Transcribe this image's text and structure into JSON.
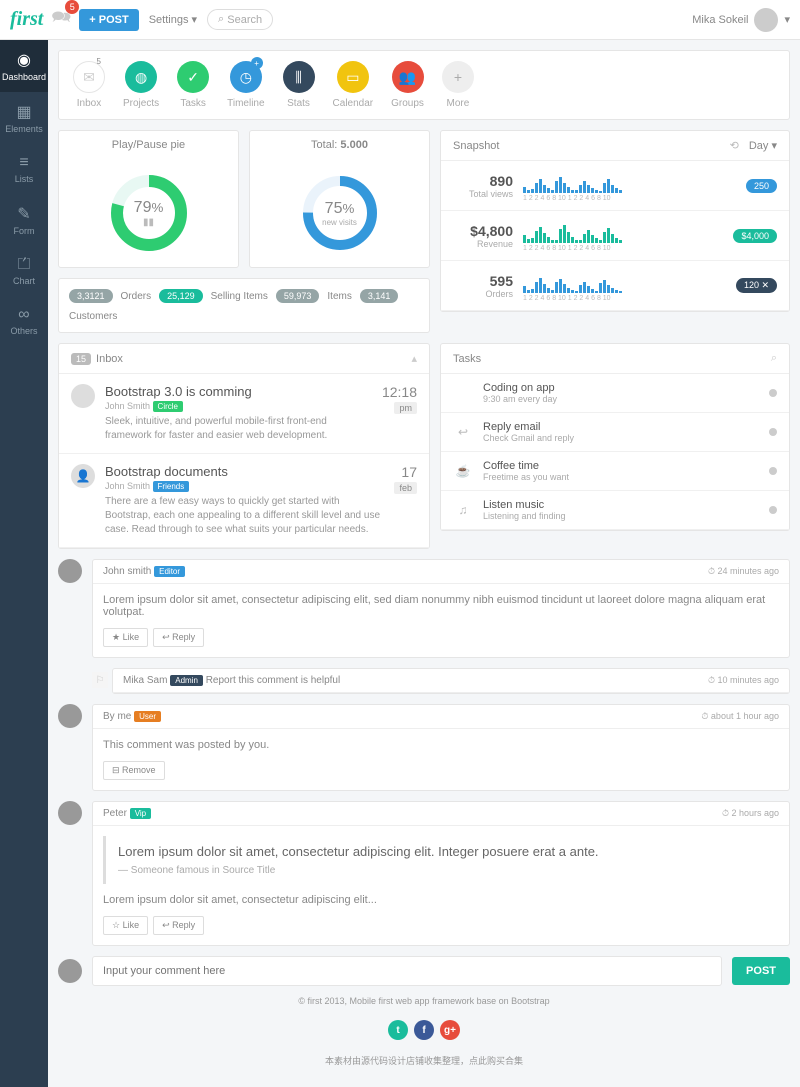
{
  "topbar": {
    "logo": "first",
    "bell_count": "5",
    "post_btn": "+ POST",
    "settings": "Settings",
    "search_icon": "⌕",
    "search_placeholder": "Search",
    "user": "Mika Sokeil"
  },
  "sidebar": [
    {
      "icon": "◉",
      "label": "Dashboard",
      "active": true
    },
    {
      "icon": "▦",
      "label": "Elements"
    },
    {
      "icon": "≡",
      "label": "Lists"
    },
    {
      "icon": "✎",
      "label": "Form"
    },
    {
      "icon": "⏍",
      "label": "Chart"
    },
    {
      "icon": "∞",
      "label": "Others"
    }
  ],
  "icons": [
    {
      "label": "Inbox",
      "color": "ic-white",
      "glyph": "✉",
      "badge": "5"
    },
    {
      "label": "Projects",
      "color": "ic-teal",
      "glyph": "◍"
    },
    {
      "label": "Tasks",
      "color": "ic-green",
      "glyph": "✓"
    },
    {
      "label": "Timeline",
      "color": "ic-blue",
      "glyph": "◷",
      "plus": "+"
    },
    {
      "label": "Stats",
      "color": "ic-dark",
      "glyph": "⫼"
    },
    {
      "label": "Calendar",
      "color": "ic-yellow",
      "glyph": "▭"
    },
    {
      "label": "Groups",
      "color": "ic-red",
      "glyph": "👥"
    },
    {
      "label": "More",
      "color": "ic-grey",
      "glyph": "+"
    }
  ],
  "pies": {
    "left": {
      "title": "Play/Pause pie",
      "percent": 79,
      "label": "%",
      "color": "#2ecc71"
    },
    "right": {
      "title_pre": "Total:",
      "title_bold": "5.000",
      "percent": 75,
      "label": "%",
      "sub": "new visits",
      "color": "#3498db"
    }
  },
  "stats": [
    {
      "val": "3,3121",
      "label": "Orders"
    },
    {
      "val": "25,129",
      "label": "Selling Items",
      "green": true
    },
    {
      "val": "59,973",
      "label": "Items"
    },
    {
      "val": "3,141",
      "label": "Customers"
    }
  ],
  "snapshot": {
    "title": "Snapshot",
    "day": "Day",
    "rows": [
      {
        "num": "890",
        "lbl": "Total views",
        "badge_bg": "#3498db",
        "badge": "250",
        "bars": [
          6,
          3,
          4,
          10,
          14,
          8,
          5,
          3,
          12,
          16,
          10,
          6,
          3,
          3,
          8,
          12,
          8,
          5,
          3,
          2,
          10,
          14,
          8,
          5,
          3
        ]
      },
      {
        "num": "$4,800",
        "lbl": "Revenue",
        "badge_bg": "#1abc9c",
        "badge": "$4,000",
        "bars": [
          8,
          4,
          5,
          12,
          16,
          10,
          6,
          3,
          3,
          14,
          18,
          11,
          6,
          3,
          3,
          9,
          13,
          8,
          5,
          3,
          11,
          15,
          9,
          5,
          3
        ],
        "teal": true
      },
      {
        "num": "595",
        "lbl": "Orders",
        "badge_bg": "#34495e",
        "badge": "120 ✕",
        "bars": [
          7,
          3,
          4,
          11,
          15,
          9,
          5,
          3,
          11,
          14,
          9,
          5,
          3,
          2,
          8,
          11,
          7,
          4,
          2,
          10,
          13,
          8,
          5,
          3,
          2
        ]
      }
    ],
    "scale": " 1 2 2  4  6  8  10 1 2 2  4  6  8  10"
  },
  "inbox": {
    "count": "15",
    "title": "Inbox",
    "items": [
      {
        "title": "Bootstrap 3.0 is comming",
        "author": "John Smith",
        "tag": "Circle",
        "tag_cls": "tag-green",
        "desc": "Sleek, intuitive, and powerful mobile-first front-end framework for faster and easier web development.",
        "time": "12:18",
        "time_lbl": "pm"
      },
      {
        "title": "Bootstrap documents",
        "author": "John Smith",
        "tag": "Friends",
        "tag_cls": "tag-blue",
        "desc": "There are a few easy ways to quickly get started with Bootstrap, each one appealing to a different skill level and use case. Read through to see what suits your particular needs.",
        "time": "17",
        "time_lbl": "feb",
        "icon": "👤"
      }
    ]
  },
  "tasks": {
    "title": "Tasks",
    "items": [
      {
        "icon": "</>",
        "title": "Coding on app",
        "sub": "9:30 am every day"
      },
      {
        "icon": "↩",
        "title": "Reply email",
        "sub": "Check Gmail and reply"
      },
      {
        "icon": "☕",
        "title": "Coffee time",
        "sub": "Freetime as you want"
      },
      {
        "icon": "♫",
        "title": "Listen music",
        "sub": "Listening and finding"
      }
    ]
  },
  "comments": [
    {
      "author": "John smith",
      "tag": "Editor",
      "tag_cls": "tag-blue",
      "time": "24 minutes ago",
      "text": "Lorem ipsum dolor sit amet, consectetur adipiscing elit, sed diam nonummy nibh euismod tincidunt ut laoreet dolore magna aliquam erat volutpat.",
      "btns": [
        "★ Like",
        "↩ Reply"
      ]
    },
    {
      "nested": true,
      "author": "Mika Sam",
      "tag": "Admin",
      "tag_cls": "tag-dark",
      "time": "10 minutes ago",
      "text": "Report this comment is helpful",
      "inline": true
    },
    {
      "author": "By me",
      "tag": "User",
      "tag_cls": "tag-orange",
      "time": "about 1 hour ago",
      "text": "This comment was posted by you.",
      "btns": [
        "⊟ Remove"
      ]
    },
    {
      "author": "Peter",
      "tag": "Vip",
      "tag_cls": "tag-teal",
      "time": "2 hours ago",
      "quote": "Lorem ipsum dolor sit amet, consectetur adipiscing elit. Integer posuere erat a ante.",
      "quote_src": "— Someone famous in Source Title",
      "text": "Lorem ipsum dolor sit amet, consectetur adipiscing elit...",
      "btns": [
        "☆ Like",
        "↩ Reply"
      ]
    }
  ],
  "comment_input": "Input your comment here",
  "post2": "POST",
  "footer": "© first 2013, Mobile first web app framework base on Bootstrap",
  "footer2": "本素材由源代码设计店铺收集整理，点此购买合集"
}
